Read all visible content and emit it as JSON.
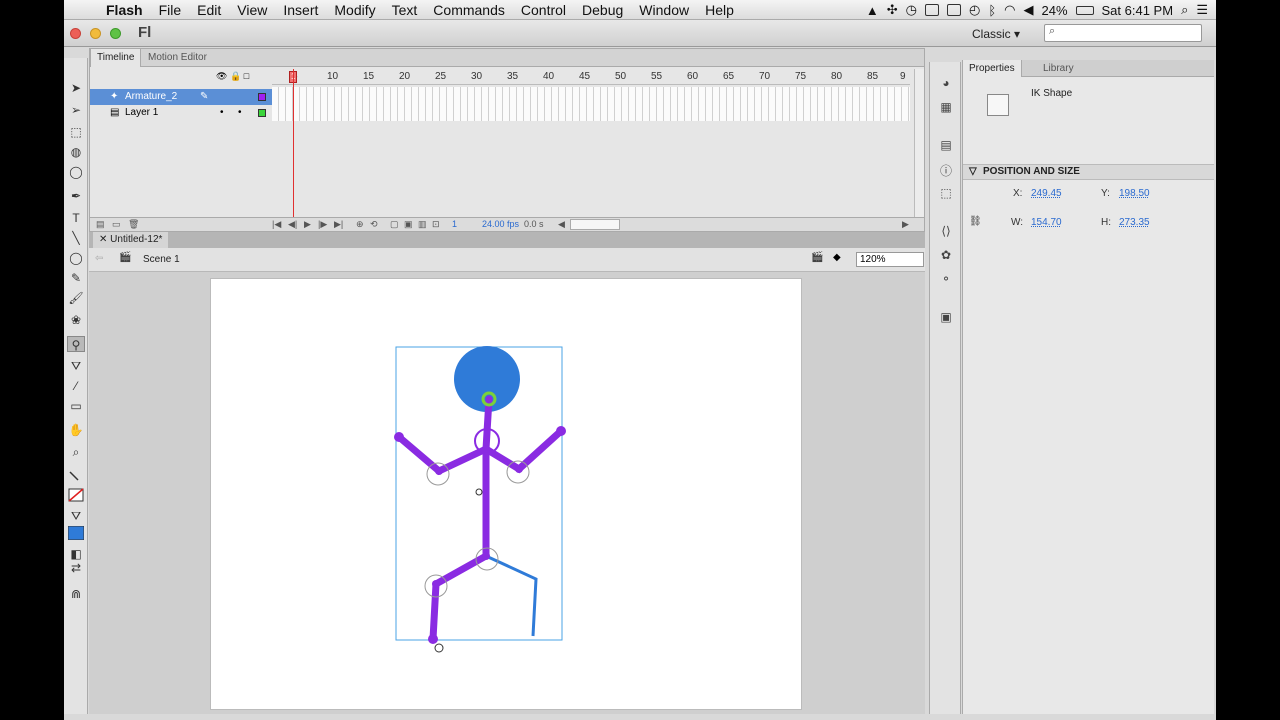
{
  "menubar": {
    "app": "Flash",
    "items": [
      "File",
      "Edit",
      "View",
      "Insert",
      "Modify",
      "Text",
      "Commands",
      "Control",
      "Debug",
      "Window",
      "Help"
    ],
    "battery": "24%",
    "clock": "Sat 6:41 PM"
  },
  "titlebar": {
    "logo": "Fl",
    "workspace": "Classic",
    "workspace_arrow": "▾"
  },
  "timeline": {
    "tabs": [
      "Timeline",
      "Motion Editor"
    ],
    "layers": [
      {
        "name": "Armature_2",
        "color": "#a020f0"
      },
      {
        "name": "Layer 1",
        "color": "#3ad43a"
      }
    ],
    "ruler": [
      "1",
      "5",
      "10",
      "15",
      "20",
      "25",
      "30",
      "35",
      "40",
      "45",
      "50",
      "55",
      "60",
      "65",
      "70",
      "75",
      "80",
      "85",
      "9"
    ],
    "current_frame": "1",
    "fps": "24.00 fps",
    "time": "0.0 s"
  },
  "document": {
    "tab": "Untitled-12*",
    "scene": "Scene 1",
    "zoom": "120%"
  },
  "properties": {
    "tabs": [
      "Properties",
      "Library"
    ],
    "object_type": "IK Shape",
    "section": "POSITION AND SIZE",
    "x_label": "X:",
    "x": "249.45",
    "y_label": "Y:",
    "y": "198.50",
    "w_label": "W:",
    "w": "154.70",
    "h_label": "H:",
    "h": "273.35"
  },
  "colors": {
    "head": "#2f7bd8",
    "bones": "#8a2be2",
    "bounding_box": "#4aa3e6",
    "stroke_color": "#e02020",
    "fill_color": "#2f7bd8"
  }
}
